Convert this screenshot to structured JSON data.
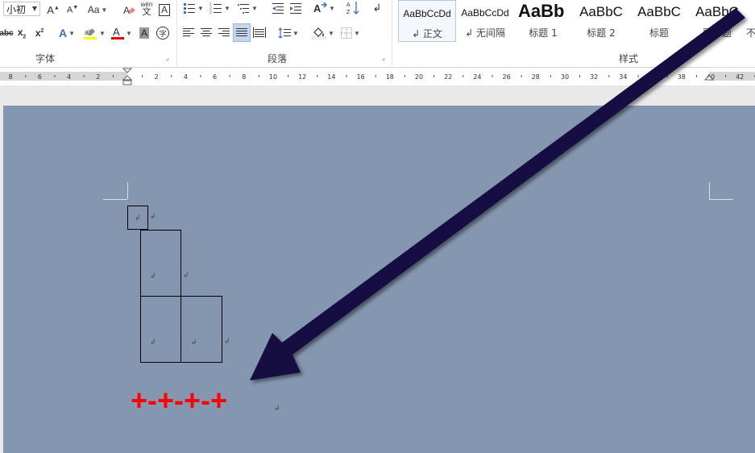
{
  "ribbon": {
    "font_group": {
      "label": "字体",
      "font_size_value": "小初",
      "case_label": "Aa",
      "phonetic_top": "wén",
      "phonetic_bottom": "文",
      "box_char": "A",
      "circle_char": "字"
    },
    "paragraph_group": {
      "label": "段落"
    },
    "styles_group": {
      "label": "样式",
      "items": [
        {
          "preview": "AaBbCcDd",
          "name": "↲ 正文",
          "selected": true
        },
        {
          "preview": "AaBbCcDd",
          "name": "↲ 无间隔",
          "selected": false
        },
        {
          "preview": "AaBb",
          "name": "标题 1",
          "selected": false
        },
        {
          "preview": "AaBbC",
          "name": "标题 2",
          "selected": false
        },
        {
          "preview": "AaBbC",
          "name": "标题",
          "selected": false
        },
        {
          "preview": "AaBbC",
          "name": "副标题",
          "selected": false
        },
        {
          "preview": "",
          "name": "不",
          "selected": false
        }
      ]
    }
  },
  "ruler": {
    "labels": [
      "8",
      "6",
      "4",
      "2",
      "2",
      "4",
      "6",
      "8",
      "10",
      "12",
      "14",
      "16",
      "18",
      "20",
      "22",
      "24",
      "26",
      "28",
      "30",
      "32",
      "34",
      "36",
      "38",
      "40",
      "42"
    ]
  },
  "document": {
    "paragraph_mark": "↲",
    "red_text": "+-+-+-+"
  },
  "colors": {
    "page_background": "#8596b0",
    "red_text": "#ff0000",
    "arrow": "#160a42"
  }
}
